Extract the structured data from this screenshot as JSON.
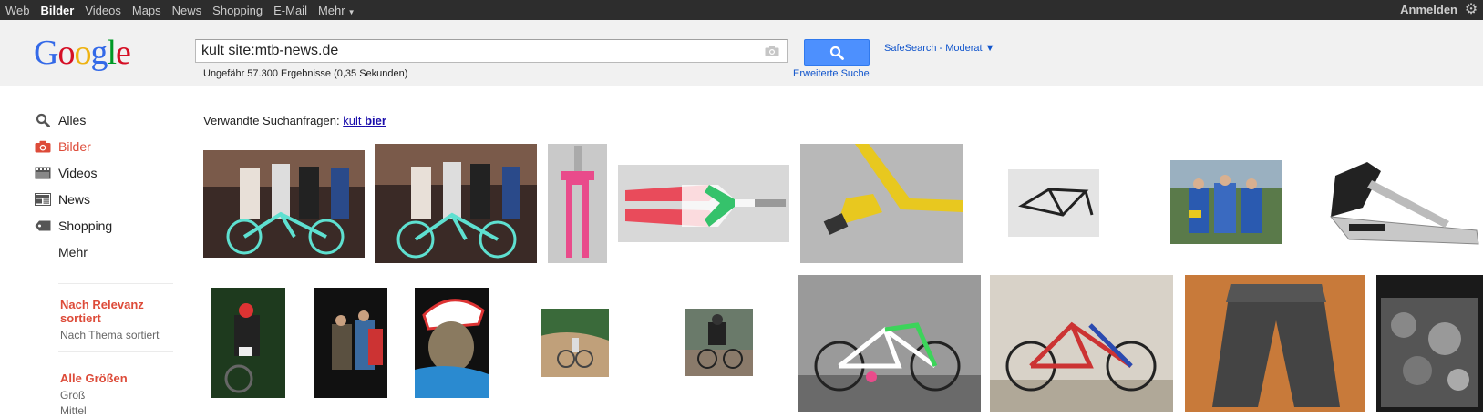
{
  "topnav": {
    "items": [
      "Web",
      "Bilder",
      "Videos",
      "Maps",
      "News",
      "Shopping",
      "E-Mail",
      "Mehr"
    ],
    "active": "Bilder",
    "signin": "Anmelden"
  },
  "logo": {
    "text": "Google"
  },
  "search": {
    "query": "kult site:mtb-news.de",
    "results_count": "Ungefähr 57.300 Ergebnisse (0,35 Sekunden)",
    "safesearch": "SafeSearch - Moderat ▼",
    "advanced": "Erweiterte Suche"
  },
  "sidebar": {
    "items": [
      {
        "label": "Alles",
        "icon": "search-icon"
      },
      {
        "label": "Bilder",
        "icon": "camera-icon"
      },
      {
        "label": "Videos",
        "icon": "film-icon"
      },
      {
        "label": "News",
        "icon": "newspaper-icon"
      },
      {
        "label": "Shopping",
        "icon": "tag-icon"
      },
      {
        "label": "Mehr",
        "icon": ""
      }
    ],
    "sort_active": "Nach Relevanz sortiert",
    "sort_other": "Nach Thema sortiert",
    "size_head": "Alle Größen",
    "size_1": "Groß",
    "size_2": "Mittel"
  },
  "related": {
    "prefix": "Verwandte Suchanfragen:",
    "link_plain": "kult",
    "link_bold": "bier"
  },
  "colors": {
    "accent_blue": "#4d90fe",
    "active_red": "#dd4b39",
    "link_blue": "#1155cc"
  }
}
